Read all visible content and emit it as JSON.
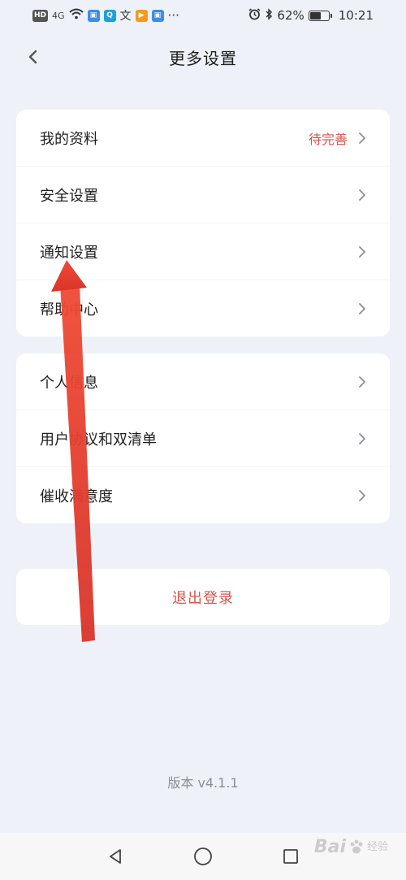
{
  "status_bar": {
    "left_badges": [
      "HD",
      "4G"
    ],
    "battery": "62%",
    "battery_level": 0.62,
    "time": "10:21",
    "more": "···"
  },
  "header": {
    "title": "更多设置"
  },
  "group1": [
    {
      "label": "我的资料",
      "status": "待完善"
    },
    {
      "label": "安全设置",
      "status": ""
    },
    {
      "label": "通知设置",
      "status": ""
    },
    {
      "label": "帮助中心",
      "status": ""
    }
  ],
  "group2": [
    {
      "label": "个人信息"
    },
    {
      "label": "用户协议和双清单"
    },
    {
      "label": "催收满意度"
    }
  ],
  "logout_label": "退出登录",
  "version": "版本 v4.1.1",
  "watermark": {
    "brand": "Bai",
    "sub": "经验"
  },
  "colors": {
    "accent_red": "#d9534a",
    "annotation_arrow": "#e8412f",
    "background": "#eef1f8"
  }
}
